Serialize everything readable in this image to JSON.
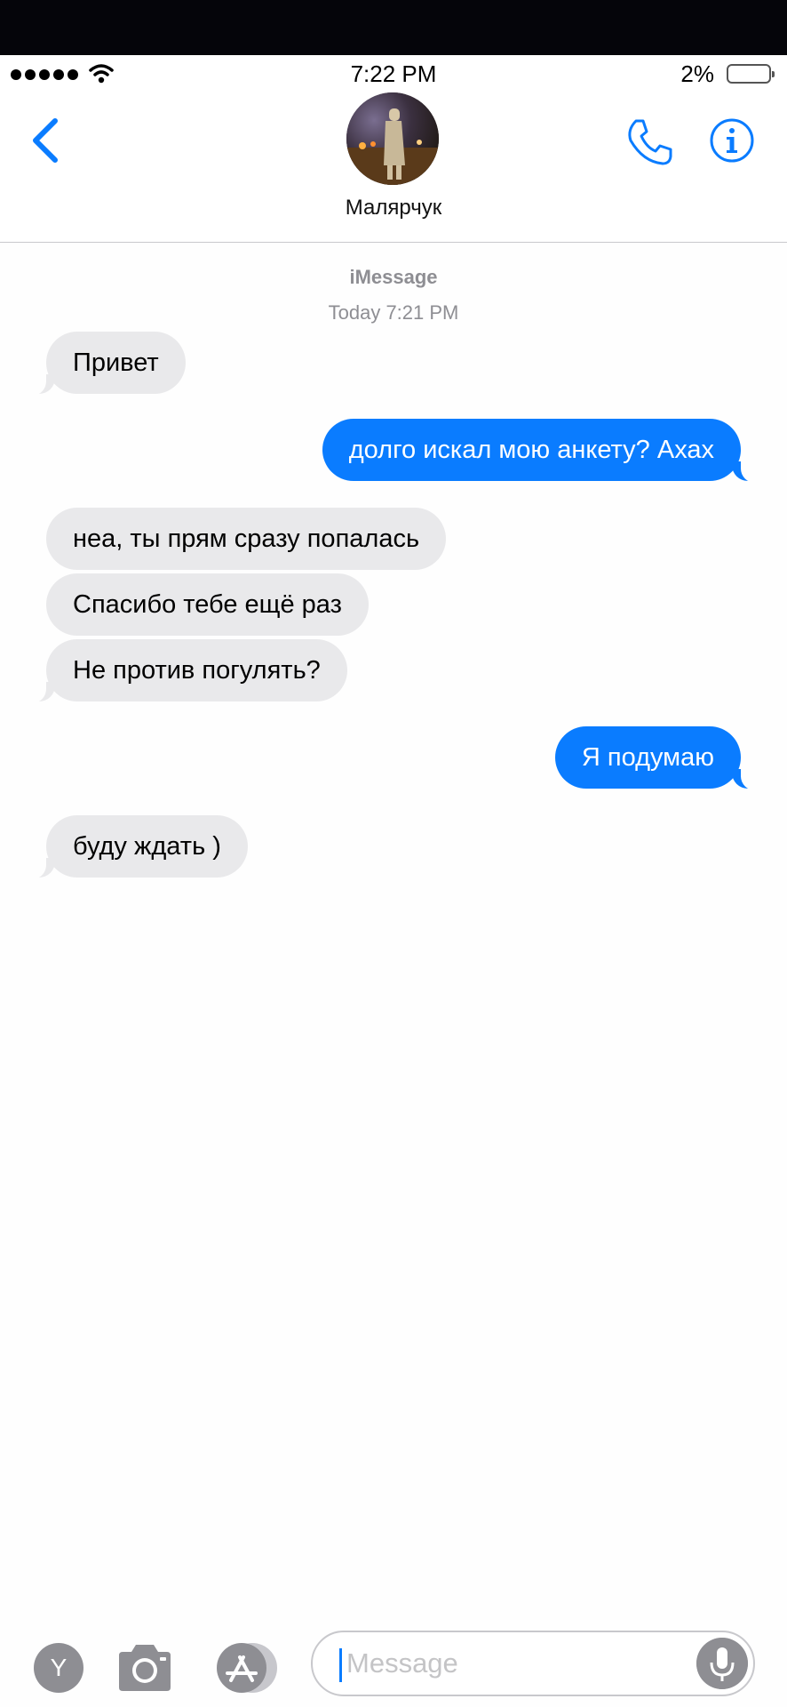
{
  "status_bar": {
    "time": "7:22 PM",
    "battery_percent": "2%",
    "signal_bars": 5
  },
  "header": {
    "contact_name": "Малярчук",
    "back_icon": "chevron-left-icon",
    "call_icon": "phone-icon",
    "info_icon": "info-icon"
  },
  "conversation": {
    "service": "iMessage",
    "timestamp": "Today 7:21 PM",
    "messages": [
      {
        "direction": "incoming",
        "text": "Привет"
      },
      {
        "direction": "outgoing",
        "text": "долго искал мою анкету? Ахах"
      },
      {
        "direction": "incoming",
        "text": "неа, ты прям сразу попалась"
      },
      {
        "direction": "incoming",
        "text": "Спасибо тебе ещё раз"
      },
      {
        "direction": "incoming",
        "text": "Не против погулять?"
      },
      {
        "direction": "outgoing",
        "text": "Я подумаю"
      },
      {
        "direction": "incoming",
        "text": "буду ждать )"
      }
    ]
  },
  "input_bar": {
    "apps_button_label": "Y",
    "placeholder": "Message",
    "icons": [
      "camera-icon",
      "app-store-icon",
      "microphone-icon"
    ]
  },
  "colors": {
    "accent": "#0a7cff",
    "incoming_bubble": "#e9e9eb",
    "meta_text": "#8e8e93"
  }
}
